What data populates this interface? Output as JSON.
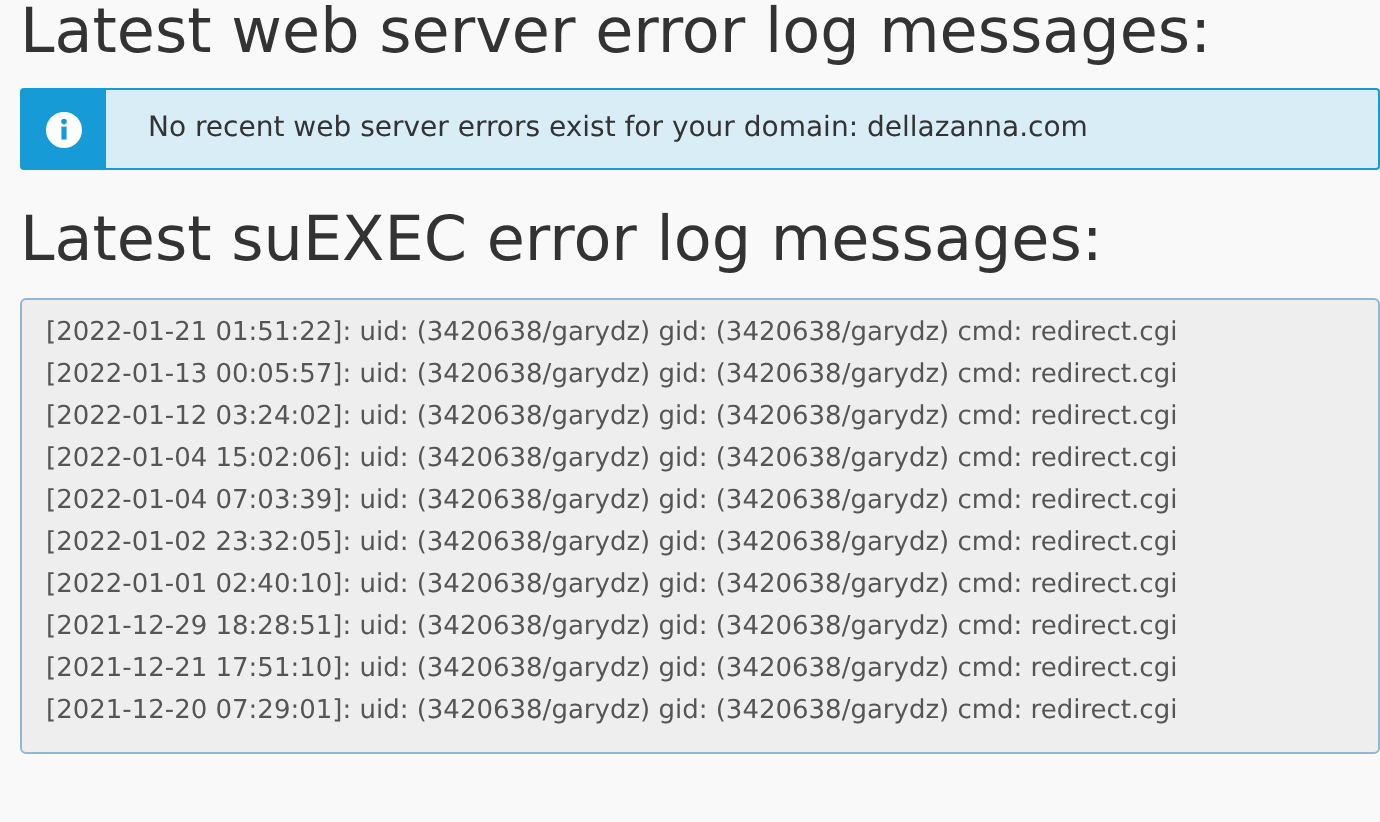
{
  "web_section": {
    "heading": "Latest web server error log messages:",
    "alert": {
      "kind": "info",
      "text": "No recent web server errors exist for your domain: dellazanna.com"
    }
  },
  "suexec_section": {
    "heading": "Latest suEXEC error log messages:",
    "log_lines": [
      "[2022-01-21 01:51:22]: uid: (3420638/garydz) gid: (3420638/garydz) cmd: redirect.cgi",
      "[2022-01-13 00:05:57]: uid: (3420638/garydz) gid: (3420638/garydz) cmd: redirect.cgi",
      "[2022-01-12 03:24:02]: uid: (3420638/garydz) gid: (3420638/garydz) cmd: redirect.cgi",
      "[2022-01-04 15:02:06]: uid: (3420638/garydz) gid: (3420638/garydz) cmd: redirect.cgi",
      "[2022-01-04 07:03:39]: uid: (3420638/garydz) gid: (3420638/garydz) cmd: redirect.cgi",
      "[2022-01-02 23:32:05]: uid: (3420638/garydz) gid: (3420638/garydz) cmd: redirect.cgi",
      "[2022-01-01 02:40:10]: uid: (3420638/garydz) gid: (3420638/garydz) cmd: redirect.cgi",
      "[2021-12-29 18:28:51]: uid: (3420638/garydz) gid: (3420638/garydz) cmd: redirect.cgi",
      "[2021-12-21 17:51:10]: uid: (3420638/garydz) gid: (3420638/garydz) cmd: redirect.cgi",
      "[2021-12-20 07:29:01]: uid: (3420638/garydz) gid: (3420638/garydz) cmd: redirect.cgi"
    ]
  }
}
